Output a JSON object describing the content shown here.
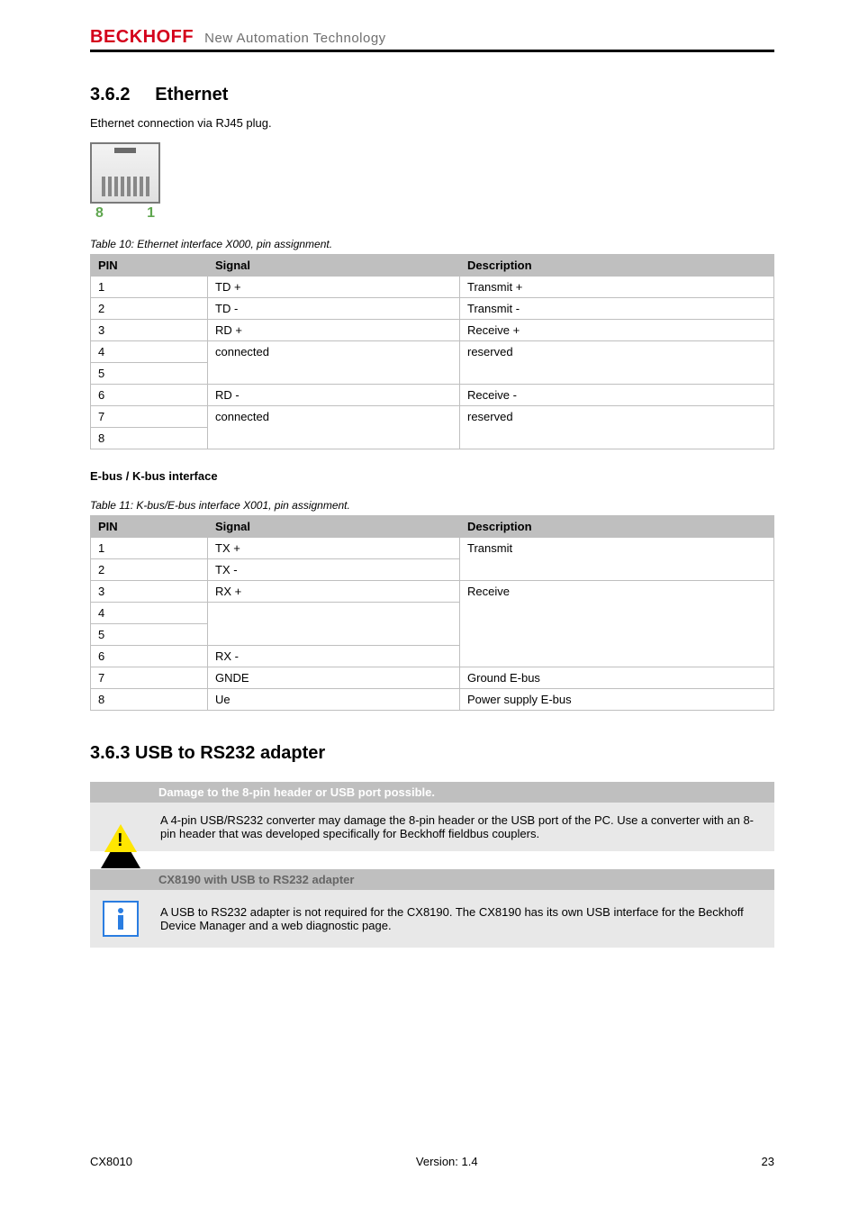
{
  "brand": {
    "name": "BECKHOFF",
    "tagline": "New Automation Technology"
  },
  "section": {
    "number": "3.6.2",
    "title": "Ethernet",
    "intro": "Ethernet connection via RJ45 plug."
  },
  "rj45": {
    "leftPin": "8",
    "rightPin": "1"
  },
  "tables": {
    "x000": {
      "caption": "Table 10: Ethernet interface X000, pin assignment.",
      "headers": [
        "PIN",
        "Signal",
        "Description"
      ],
      "rows": [
        [
          "1",
          "TD +",
          "Transmit +"
        ],
        [
          "2",
          "TD -",
          "Transmit -"
        ],
        [
          "3",
          "RD +",
          "Receive +"
        ],
        [
          "4",
          "connected",
          "reserved"
        ],
        [
          "5",
          "",
          ""
        ],
        [
          "6",
          "RD -",
          "Receive -"
        ],
        [
          "7",
          "connected",
          "reserved"
        ],
        [
          "8",
          "",
          ""
        ]
      ]
    },
    "x001": {
      "caption_heading": "E-bus / K-bus interface",
      "caption": "Table 11: K-bus/E-bus interface X001, pin assignment.",
      "headers": [
        "PIN",
        "Signal",
        "Description"
      ],
      "rows": [
        [
          "1",
          "TX +",
          "Transmit"
        ],
        [
          "2",
          "TX -",
          ""
        ],
        [
          "3",
          "RX +",
          "Receive"
        ],
        [
          "4",
          "",
          ""
        ],
        [
          "5",
          "",
          ""
        ],
        [
          "6",
          "RX -",
          ""
        ],
        [
          "7",
          "GNDE",
          "Ground E-bus"
        ],
        [
          "8",
          "Ue",
          "Power supply E-bus"
        ]
      ]
    }
  },
  "usb_heading": "3.6.3    USB to RS232 adapter",
  "warning": {
    "title": "Damage to the 8-pin header or USB port possible.",
    "body": "A 4-pin USB/RS232 converter may damage the 8-pin header or the USB port of the PC. Use a converter with an 8-pin header that was developed specifically for Beckhoff fieldbus couplers."
  },
  "note": {
    "title": "CX8190 with USB to RS232 adapter",
    "body": "A USB to RS232 adapter is not required for the CX8190. The CX8190 has its own USB interface for the Beckhoff Device Manager and a web diagnostic page."
  },
  "footer": {
    "docref": "CX8010",
    "version": "Version: 1.4",
    "page": "23"
  }
}
